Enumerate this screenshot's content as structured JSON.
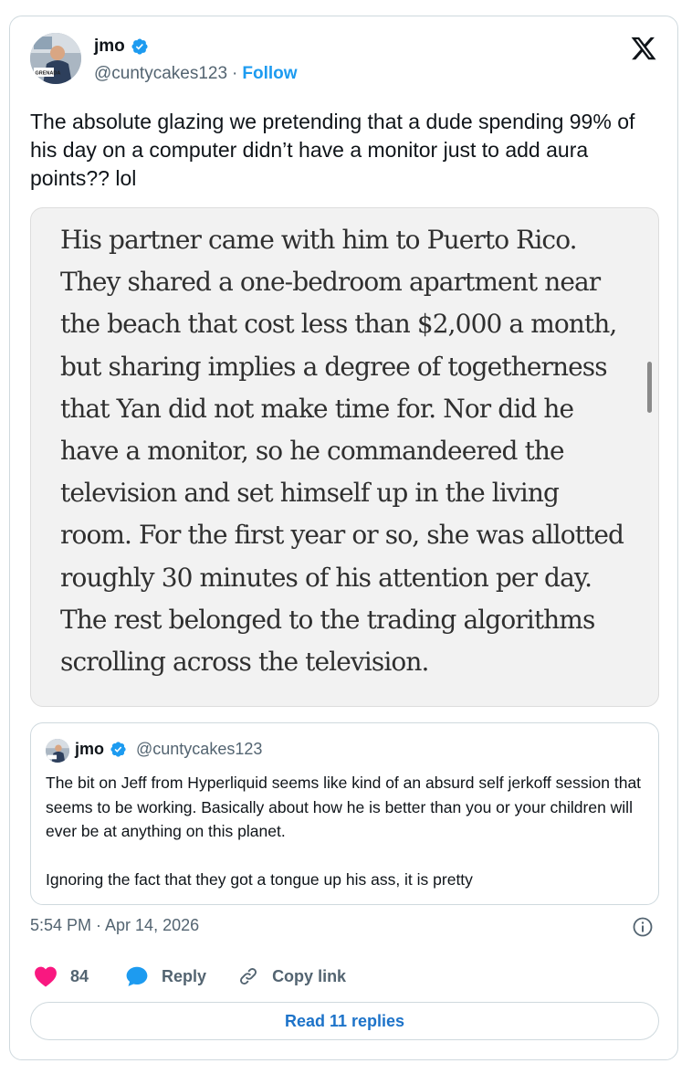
{
  "author": {
    "name": "jmo",
    "handle": "@cuntycakes123",
    "separator": "·",
    "follow_label": "Follow",
    "verified_icon": "verified-badge-icon",
    "avatar_desk_sign": "GRENADA"
  },
  "tweet": {
    "text": "The absolute glazing we pretending that a dude spending 99% of his day on a computer didn’t have a monitor just to add aura points?? lol",
    "media_text": "His partner came with him to Puerto Rico. They shared a one-bedroom apartment near the beach that cost less than $2,000 a month, but sharing implies a degree of togetherness that Yan did not make time for. Nor did he have a monitor, so he commandeered the television and set himself up in the living room. For the first year or so, she was allotted roughly 30 minutes of his attention per day. The rest belonged to the trading algorithms scrolling across the television."
  },
  "quote": {
    "name": "jmo",
    "handle": "@cuntycakes123",
    "text": "The bit on Jeff from Hyperliquid seems like kind of an absurd self jerkoff session that seems to be working.  Basically about how he is better than you or your children will ever be at anything on this planet.\n\nIgnoring the fact that they got a tongue up his ass, it is pretty"
  },
  "meta": {
    "timestamp": "5:54 PM · Apr 14, 2026"
  },
  "actions": {
    "like_count": "84",
    "reply_label": "Reply",
    "copy_link_label": "Copy link"
  },
  "footer": {
    "read_replies_label": "Read 11 replies"
  },
  "colors": {
    "accent": "#1d9bf0",
    "heart": "#f91880",
    "text": "#0f1419",
    "muted": "#536471",
    "border": "#cfd9de"
  }
}
